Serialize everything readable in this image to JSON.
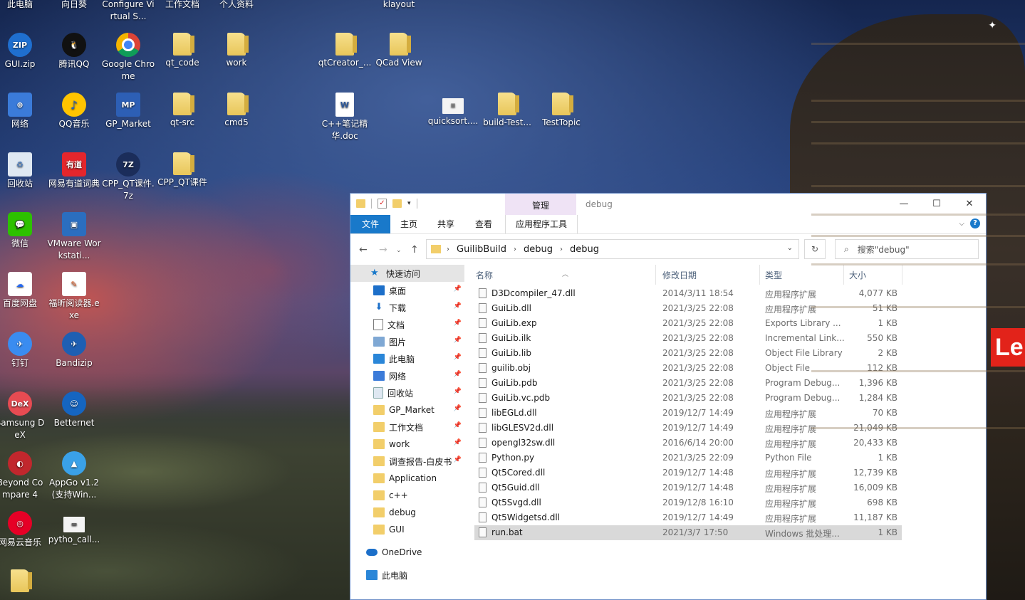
{
  "desktop": {
    "icons": [
      {
        "label": "此电脑",
        "kind": "folder"
      },
      {
        "label": "向日葵",
        "kind": "folder"
      },
      {
        "label": "Configure Virtual S...",
        "kind": "folder"
      },
      {
        "label": "工作文档",
        "kind": "folder"
      },
      {
        "label": "个人资料",
        "kind": "folder"
      },
      {
        "label": "klayout",
        "kind": "folder"
      },
      {
        "label": "GUI.zip",
        "kind": "zip",
        "glyph": "ZIP"
      },
      {
        "label": "腾讯QQ",
        "kind": "qq",
        "glyph": "🐧"
      },
      {
        "label": "Google Chrome",
        "kind": "chrome"
      },
      {
        "label": "qt_code",
        "kind": "folder"
      },
      {
        "label": "work",
        "kind": "folder"
      },
      {
        "label": "qtCreator_...",
        "kind": "folder"
      },
      {
        "label": "QCad View",
        "kind": "folder"
      },
      {
        "label": "网络",
        "kind": "net",
        "glyph": "⊕"
      },
      {
        "label": "QQ音乐",
        "kind": "music",
        "glyph": "♪"
      },
      {
        "label": "GP_Market",
        "kind": "gp",
        "glyph": "MP"
      },
      {
        "label": "qt-src",
        "kind": "folder"
      },
      {
        "label": "cmd5",
        "kind": "folder"
      },
      {
        "label": "C++笔记精华.doc",
        "kind": "doc",
        "glyph": "W"
      },
      {
        "label": "quicksort....",
        "kind": "thumb",
        "glyph": "≡"
      },
      {
        "label": "build-Test...",
        "kind": "folder"
      },
      {
        "label": "TestTopic",
        "kind": "folder"
      },
      {
        "label": "回收站",
        "kind": "recycle",
        "glyph": "♻"
      },
      {
        "label": "网易有道词典",
        "kind": "youdao",
        "glyph": "有道"
      },
      {
        "label": "CPP_QT课件.7z",
        "kind": "z7",
        "glyph": "7Z"
      },
      {
        "label": "CPP_QT课件",
        "kind": "folder"
      },
      {
        "label": "微信",
        "kind": "wx",
        "glyph": "💬"
      },
      {
        "label": "VMware Workstati...",
        "kind": "vm",
        "glyph": "▣"
      },
      {
        "label": "百度网盘",
        "kind": "baidu",
        "glyph": "☁"
      },
      {
        "label": "福昕阅读器.exe",
        "kind": "foxit",
        "glyph": "✎"
      },
      {
        "label": "钉钉",
        "kind": "ding",
        "glyph": "✈"
      },
      {
        "label": "Bandizip",
        "kind": "bandi",
        "glyph": "✈"
      },
      {
        "label": "Samsung DeX",
        "kind": "dex",
        "glyph": "DeX"
      },
      {
        "label": "Betternet",
        "kind": "better",
        "glyph": "☺"
      },
      {
        "label": "Beyond Compare 4",
        "kind": "beyond",
        "glyph": "◐"
      },
      {
        "label": "AppGo v1.2 (支持Win...",
        "kind": "appgo",
        "glyph": "▲"
      },
      {
        "label": "网易云音乐",
        "kind": "wyy",
        "glyph": "◎"
      },
      {
        "label": "pytho_call...",
        "kind": "thumb",
        "glyph": "▬"
      },
      {
        "label": "",
        "kind": "folder"
      }
    ]
  },
  "explorer": {
    "title": "debug",
    "manage_tab": "管理",
    "ribbon_tabs": [
      "文件",
      "主页",
      "共享",
      "查看",
      "应用程序工具"
    ],
    "window_buttons": {
      "minimize": "—",
      "maximize": "☐",
      "close": "✕"
    },
    "breadcrumb": [
      "GuilibBuild",
      "debug",
      "debug"
    ],
    "search_placeholder": "搜索\"debug\"",
    "nav": [
      {
        "label": "快速访问",
        "icon": "star",
        "pinned": false
      },
      {
        "label": "桌面",
        "icon": "blue",
        "pinned": true
      },
      {
        "label": "下载",
        "icon": "dl",
        "pinned": true
      },
      {
        "label": "文档",
        "icon": "doc",
        "pinned": true
      },
      {
        "label": "图片",
        "icon": "pic",
        "pinned": true
      },
      {
        "label": "此电脑",
        "icon": "pc",
        "pinned": true
      },
      {
        "label": "网络",
        "icon": "net",
        "pinned": true
      },
      {
        "label": "回收站",
        "icon": "bin",
        "pinned": true
      },
      {
        "label": "GP_Market",
        "icon": "fld",
        "pinned": true
      },
      {
        "label": "工作文档",
        "icon": "fld",
        "pinned": true
      },
      {
        "label": "work",
        "icon": "fld",
        "pinned": true
      },
      {
        "label": "调查报告-白皮书",
        "icon": "fld",
        "pinned": true
      },
      {
        "label": "Application",
        "icon": "fld",
        "pinned": false
      },
      {
        "label": "c++",
        "icon": "fld",
        "pinned": false
      },
      {
        "label": "debug",
        "icon": "fld",
        "pinned": false
      },
      {
        "label": "GUI",
        "icon": "fld",
        "pinned": false
      },
      {
        "label": "OneDrive",
        "icon": "cloud",
        "pinned": false
      },
      {
        "label": "此电脑",
        "icon": "pc",
        "pinned": false
      }
    ],
    "columns": {
      "name": "名称",
      "date": "修改日期",
      "type": "类型",
      "size": "大小"
    },
    "files": [
      {
        "name": "D3Dcompiler_47.dll",
        "date": "2014/3/11 18:54",
        "type": "应用程序扩展",
        "size": "4,077 KB"
      },
      {
        "name": "GuiLib.dll",
        "date": "2021/3/25 22:08",
        "type": "应用程序扩展",
        "size": "51 KB"
      },
      {
        "name": "GuiLib.exp",
        "date": "2021/3/25 22:08",
        "type": "Exports Library ...",
        "size": "1 KB"
      },
      {
        "name": "GuiLib.ilk",
        "date": "2021/3/25 22:08",
        "type": "Incremental Link...",
        "size": "550 KB"
      },
      {
        "name": "GuiLib.lib",
        "date": "2021/3/25 22:08",
        "type": "Object File Library",
        "size": "2 KB"
      },
      {
        "name": "guilib.obj",
        "date": "2021/3/25 22:08",
        "type": "Object File",
        "size": "112 KB"
      },
      {
        "name": "GuiLib.pdb",
        "date": "2021/3/25 22:08",
        "type": "Program Debug...",
        "size": "1,396 KB"
      },
      {
        "name": "GuiLib.vc.pdb",
        "date": "2021/3/25 22:08",
        "type": "Program Debug...",
        "size": "1,284 KB"
      },
      {
        "name": "libEGLd.dll",
        "date": "2019/12/7 14:49",
        "type": "应用程序扩展",
        "size": "70 KB"
      },
      {
        "name": "libGLESV2d.dll",
        "date": "2019/12/7 14:49",
        "type": "应用程序扩展",
        "size": "21,049 KB"
      },
      {
        "name": "opengl32sw.dll",
        "date": "2016/6/14 20:00",
        "type": "应用程序扩展",
        "size": "20,433 KB"
      },
      {
        "name": "Python.py",
        "date": "2021/3/25 22:09",
        "type": "Python File",
        "size": "1 KB"
      },
      {
        "name": "Qt5Cored.dll",
        "date": "2019/12/7 14:48",
        "type": "应用程序扩展",
        "size": "12,739 KB"
      },
      {
        "name": "Qt5Guid.dll",
        "date": "2019/12/7 14:48",
        "type": "应用程序扩展",
        "size": "16,009 KB"
      },
      {
        "name": "Qt5Svgd.dll",
        "date": "2019/12/8 16:10",
        "type": "应用程序扩展",
        "size": "698 KB"
      },
      {
        "name": "Qt5Widgetsd.dll",
        "date": "2019/12/7 14:49",
        "type": "应用程序扩展",
        "size": "11,187 KB"
      },
      {
        "name": "run.bat",
        "date": "2021/3/7 17:50",
        "type": "Windows 批处理...",
        "size": "1 KB",
        "selected": true
      }
    ]
  },
  "brand_tag": "Le"
}
